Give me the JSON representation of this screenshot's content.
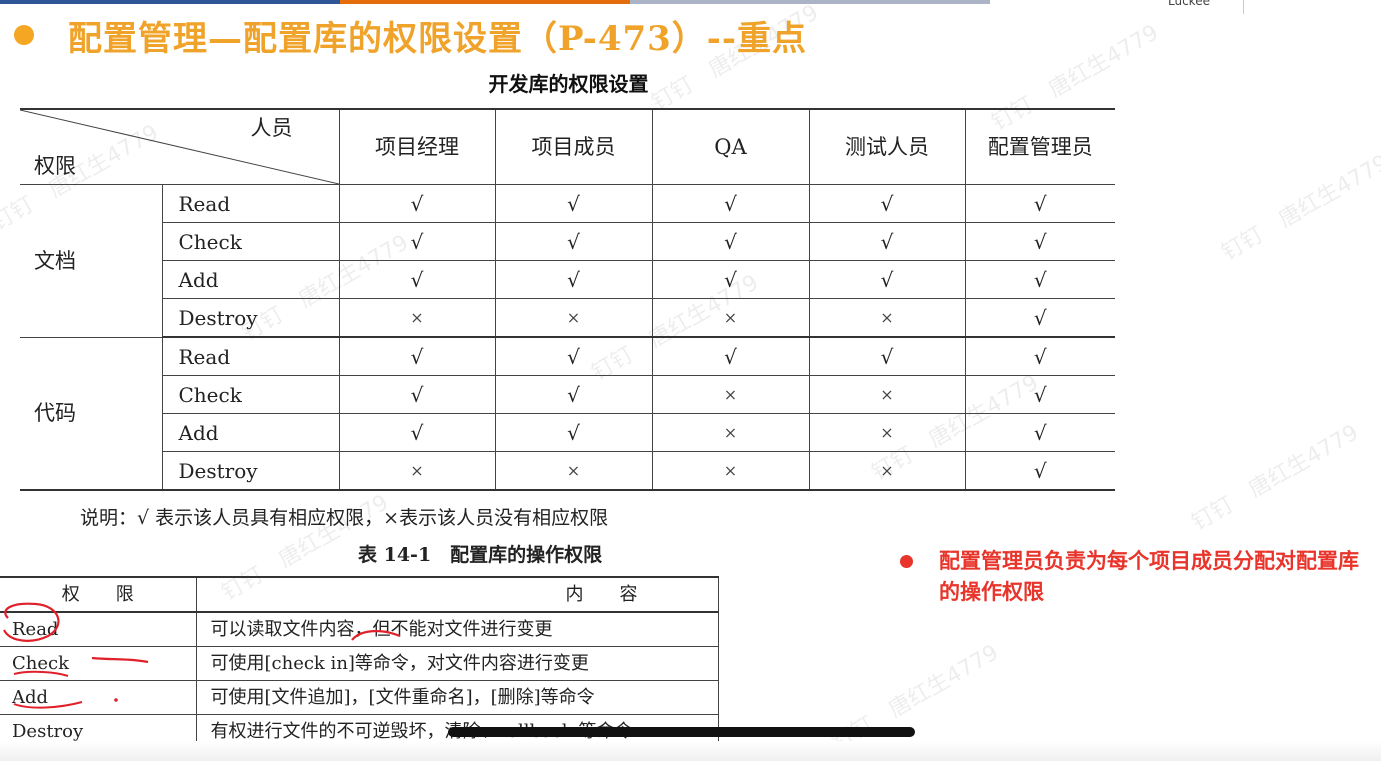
{
  "logo_text": "Luckee",
  "title": "配置管理—配置库的权限设置（P-473）--重点",
  "table1": {
    "caption": "开发库的权限设置",
    "header_staff": "人员",
    "header_permission": "权限",
    "columns": [
      "项目经理",
      "项目成员",
      "QA",
      "测试人员",
      "配置管理员"
    ],
    "groups": [
      {
        "category": "文档",
        "rows": [
          {
            "op": "Read",
            "marks": [
              "√",
              "√",
              "√",
              "√",
              "√"
            ]
          },
          {
            "op": "Check",
            "marks": [
              "√",
              "√",
              "√",
              "√",
              "√"
            ]
          },
          {
            "op": "Add",
            "marks": [
              "√",
              "√",
              "√",
              "√",
              "√"
            ]
          },
          {
            "op": "Destroy",
            "marks": [
              "×",
              "×",
              "×",
              "×",
              "√"
            ]
          }
        ]
      },
      {
        "category": "代码",
        "rows": [
          {
            "op": "Read",
            "marks": [
              "√",
              "√",
              "√",
              "√",
              "√"
            ]
          },
          {
            "op": "Check",
            "marks": [
              "√",
              "√",
              "×",
              "×",
              "√"
            ]
          },
          {
            "op": "Add",
            "marks": [
              "√",
              "√",
              "×",
              "×",
              "√"
            ]
          },
          {
            "op": "Destroy",
            "marks": [
              "×",
              "×",
              "×",
              "×",
              "√"
            ]
          }
        ]
      }
    ],
    "note": "说明：√ 表示该人员具有相应权限，×表示该人员没有相应权限"
  },
  "table2": {
    "caption": "表 14-1　配置库的操作权限",
    "headers": [
      "权　　限",
      "内　　容"
    ],
    "rows": [
      {
        "perm": "Read",
        "content": "可以读取文件内容，但不能对文件进行变更"
      },
      {
        "perm": "Check",
        "content": "可使用[check in]等命令，对文件内容进行变更"
      },
      {
        "perm": "Add",
        "content": "可使用[文件追加]，[文件重命名]，[删除]等命令"
      },
      {
        "perm": "Destroy",
        "content": "有权进行文件的不可逆毁坏，清除、rollback 等命令"
      }
    ]
  },
  "bullet": "配置管理员负责为每个项目成员分配对配置库的操作权限",
  "watermark": "钉钉　唐红生4779",
  "colors": {
    "title": "#f0a32a",
    "bullet": "#e8342a",
    "title_dot": "#f5a623"
  }
}
